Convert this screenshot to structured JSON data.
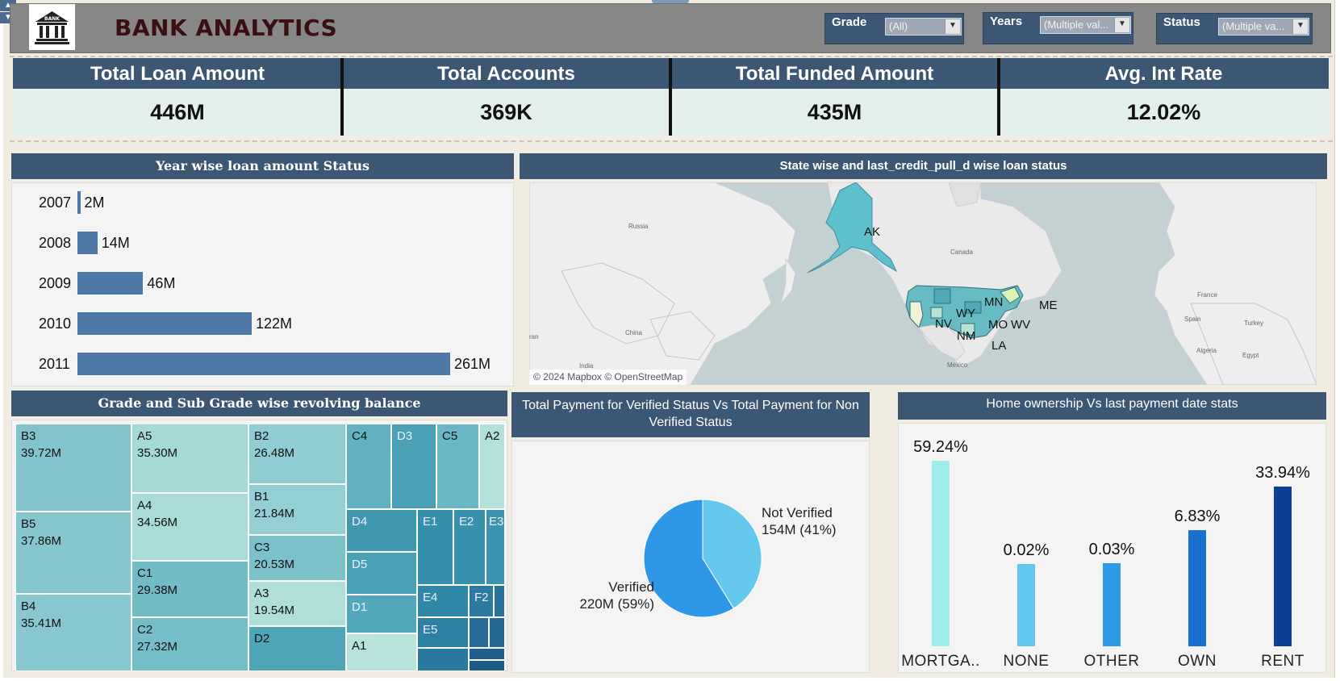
{
  "header": {
    "title": "BANK ANALYTICS",
    "logo_text": "BANK",
    "filters": [
      {
        "label": "Grade",
        "value": "(All)"
      },
      {
        "label": "Years",
        "value": "(Multiple val..."
      },
      {
        "label": "Status",
        "value": "(Multiple va..."
      }
    ]
  },
  "kpis": [
    {
      "label": "Total Loan Amount",
      "value": "446M"
    },
    {
      "label": "Total Accounts",
      "value": "369K"
    },
    {
      "label": "Total Funded Amount",
      "value": "435M"
    },
    {
      "label": "Avg. Int Rate",
      "value": "12.02%"
    }
  ],
  "year_panel": {
    "title": "Year wise loan amount Status",
    "chart_data": {
      "type": "bar",
      "orientation": "horizontal",
      "categories": [
        "2007",
        "2008",
        "2009",
        "2010",
        "2011"
      ],
      "values": [
        2,
        14,
        46,
        122,
        261
      ],
      "value_labels": [
        "2M",
        "14M",
        "46M",
        "122M",
        "261M"
      ],
      "unit": "M",
      "color": "#4e79a7"
    }
  },
  "map_panel": {
    "title": "State wise and last_credit_pull_d wise loan status",
    "attribution": "© 2024 Mapbox © OpenStreetMap",
    "place_labels": [
      "Russia",
      "Canada",
      "China",
      "India",
      "Mexico",
      "France",
      "Spain",
      "Turkey",
      "Algeria",
      "Egypt",
      "ran"
    ],
    "state_labels": [
      "AK",
      "MN",
      "ME",
      "WY",
      "NV",
      "MO",
      "WV",
      "NM",
      "LA"
    ]
  },
  "treemap_panel": {
    "title": "Grade and Sub Grade wise revolving balance",
    "cells": [
      {
        "grade": "B3",
        "value": "39.72M"
      },
      {
        "grade": "B5",
        "value": "37.86M"
      },
      {
        "grade": "B4",
        "value": "35.41M"
      },
      {
        "grade": "A5",
        "value": "35.30M"
      },
      {
        "grade": "A4",
        "value": "34.56M"
      },
      {
        "grade": "C1",
        "value": "29.38M"
      },
      {
        "grade": "C2",
        "value": "27.32M"
      },
      {
        "grade": "B2",
        "value": "26.48M"
      },
      {
        "grade": "B1",
        "value": "21.84M"
      },
      {
        "grade": "C3",
        "value": "20.53M"
      },
      {
        "grade": "A3",
        "value": "19.54M"
      },
      {
        "grade": "D2",
        "value": ""
      },
      {
        "grade": "C4",
        "value": ""
      },
      {
        "grade": "D3",
        "value": ""
      },
      {
        "grade": "C5",
        "value": ""
      },
      {
        "grade": "A2",
        "value": ""
      },
      {
        "grade": "D4",
        "value": ""
      },
      {
        "grade": "E1",
        "value": ""
      },
      {
        "grade": "E2",
        "value": ""
      },
      {
        "grade": "E3",
        "value": ""
      },
      {
        "grade": "D5",
        "value": ""
      },
      {
        "grade": "E4",
        "value": ""
      },
      {
        "grade": "F2",
        "value": ""
      },
      {
        "grade": "D1",
        "value": ""
      },
      {
        "grade": "E5",
        "value": ""
      },
      {
        "grade": "A1",
        "value": ""
      }
    ]
  },
  "pie_panel": {
    "title_line1": "Total Payment for Verified Status Vs Total Payment for Non",
    "title_line2": "Verified Status",
    "chart_data": {
      "type": "pie",
      "slices": [
        {
          "name": "Not Verified",
          "label": "154M (41%)",
          "value": 154,
          "percent": 41,
          "color": "#64c8ec"
        },
        {
          "name": "Verified",
          "label": "220M (59%)",
          "value": 220,
          "percent": 59,
          "color": "#2f97e8"
        }
      ]
    }
  },
  "home_panel": {
    "title": "Home ownership Vs last payment date stats",
    "chart_data": {
      "type": "bar",
      "orientation": "vertical",
      "categories": [
        "MORTGA..",
        "NONE",
        "OTHER",
        "OWN",
        "RENT"
      ],
      "values": [
        59.24,
        0.02,
        0.03,
        6.83,
        33.94
      ],
      "value_labels": [
        "59.24%",
        "0.02%",
        "0.03%",
        "6.83%",
        "33.94%"
      ],
      "colors": [
        "#9eeeec",
        "#62c7ee",
        "#2f9ae6",
        "#1a6fcf",
        "#0a3f96"
      ]
    }
  }
}
